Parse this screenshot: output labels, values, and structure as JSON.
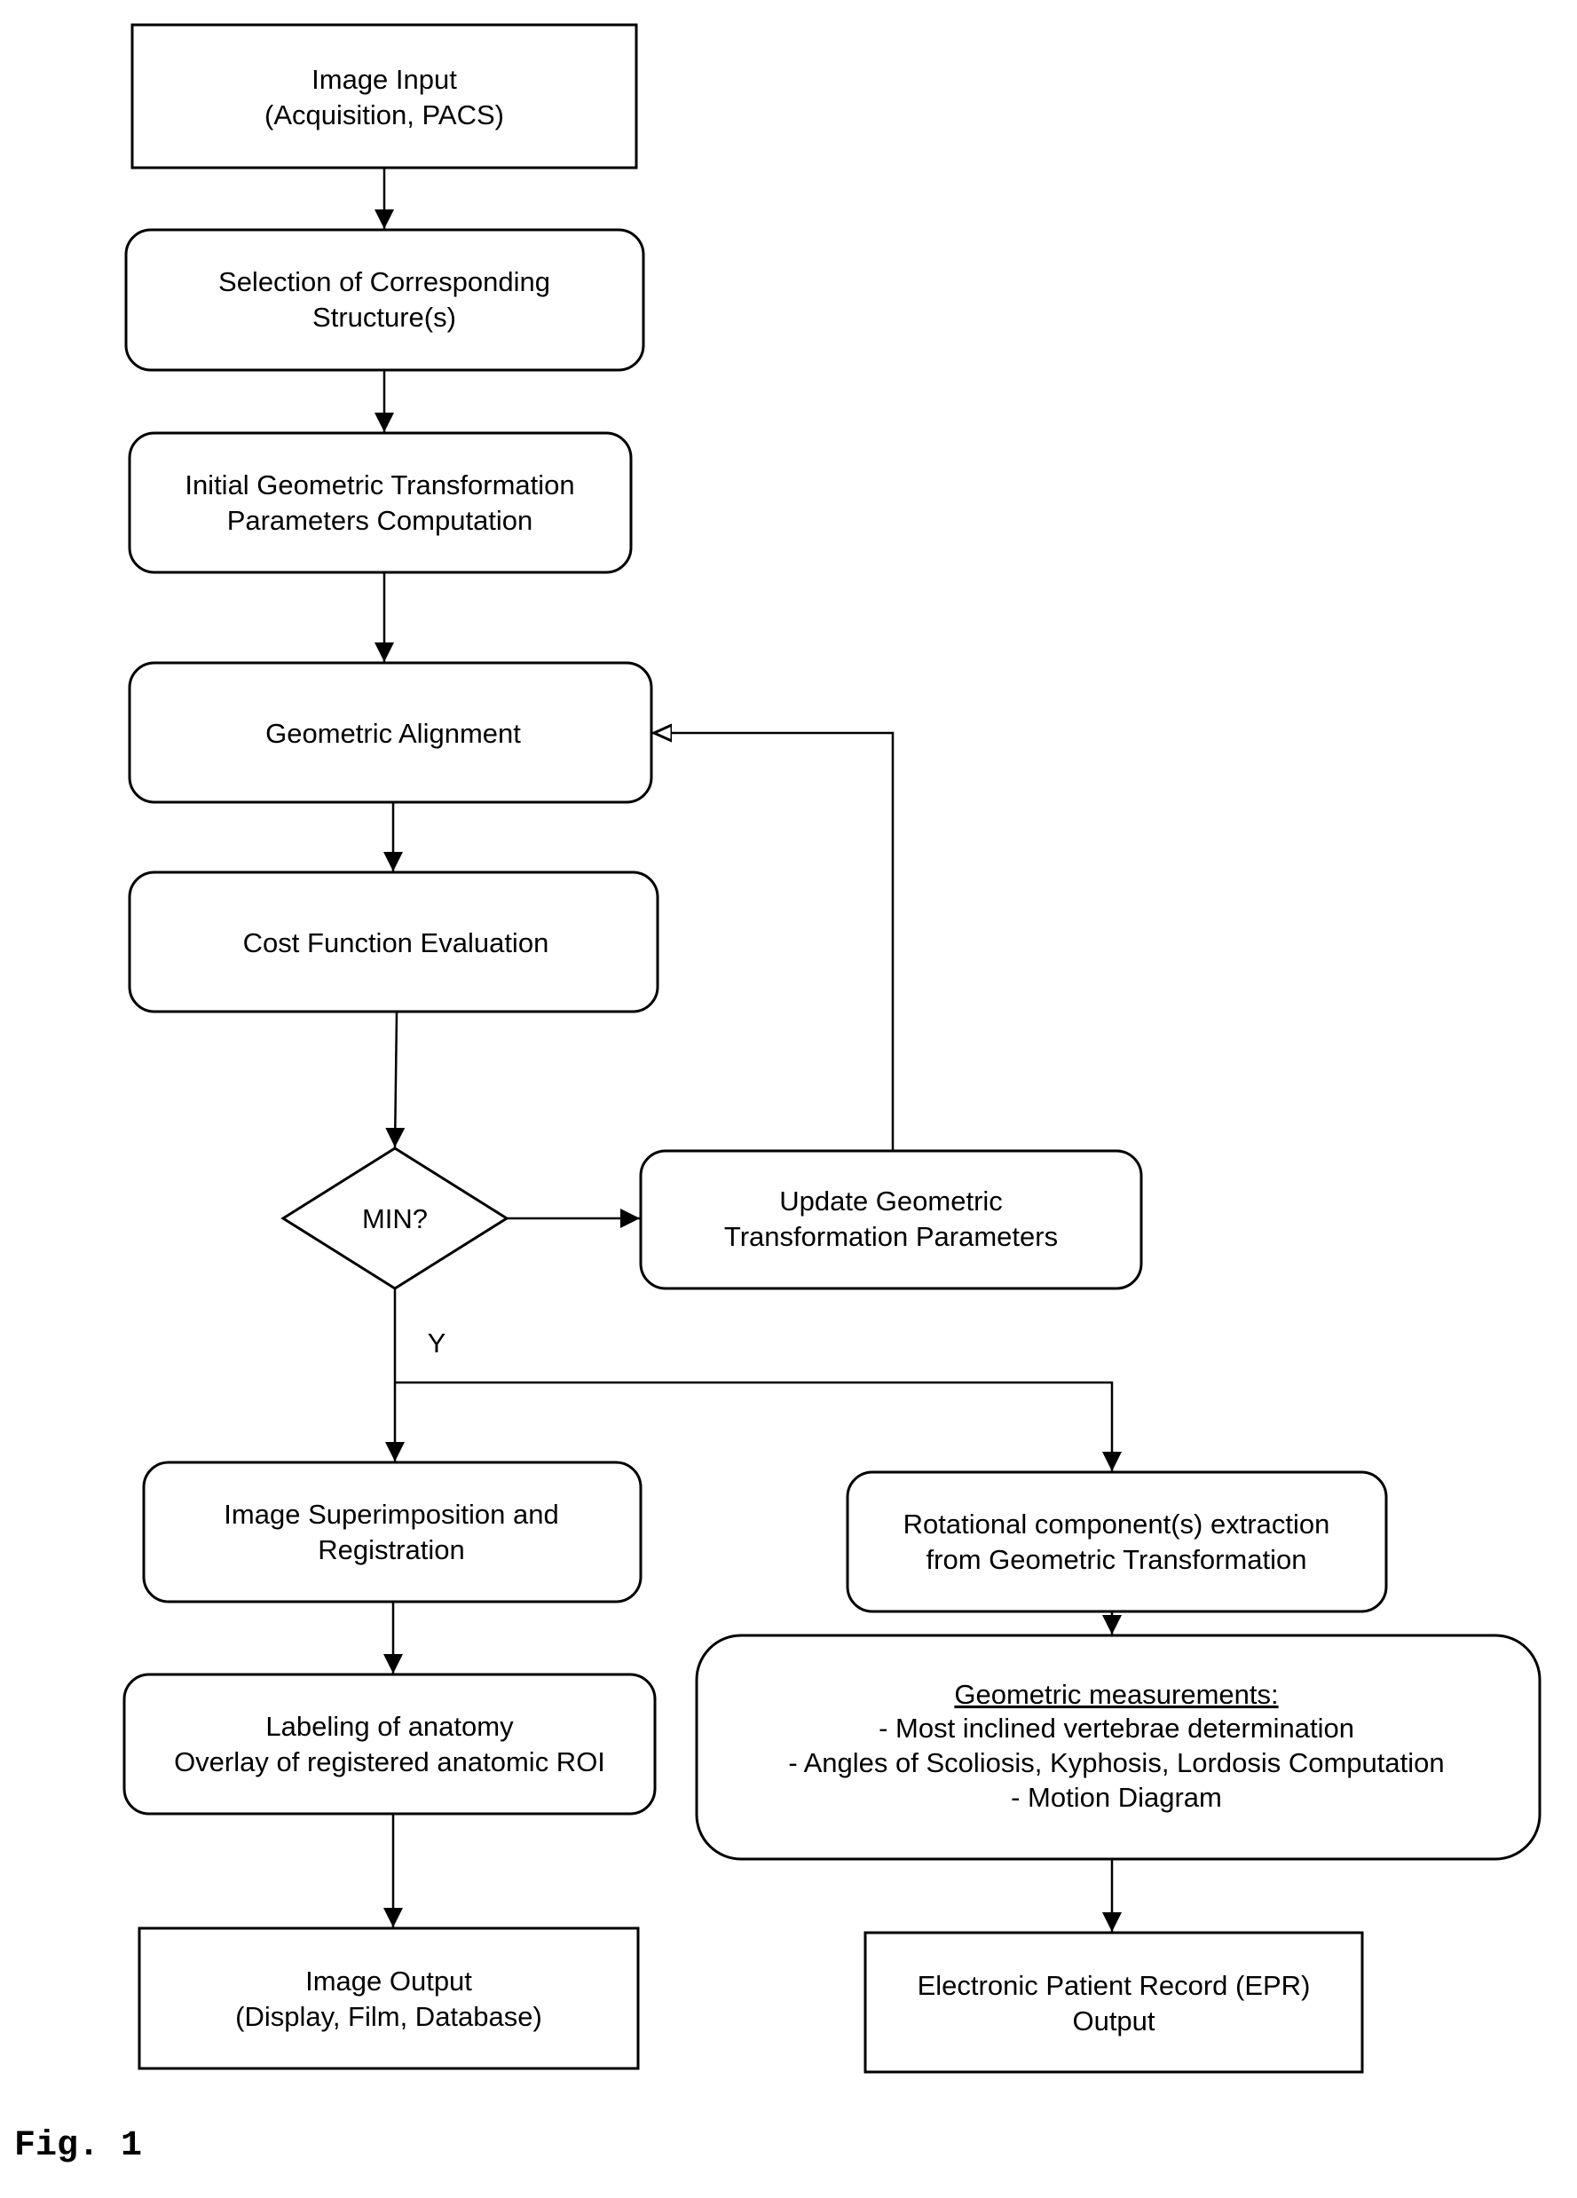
{
  "figure": {
    "caption": "Fig. 1",
    "nodes": {
      "image_input": {
        "lines": [
          "Image Input",
          "(Acquisition, PACS)"
        ]
      },
      "selection": {
        "lines": [
          "Selection of Corresponding",
          "Structure(s)"
        ]
      },
      "initial_params": {
        "lines": [
          "Initial Geometric Transformation",
          "Parameters Computation"
        ]
      },
      "alignment": {
        "lines": [
          "Geometric Alignment"
        ]
      },
      "cost": {
        "lines": [
          "Cost Function Evaluation"
        ]
      },
      "decision": {
        "lines": [
          "MIN?"
        ]
      },
      "update": {
        "lines": [
          "Update Geometric",
          "Transformation Parameters"
        ]
      },
      "superimposition": {
        "lines": [
          "Image Superimposition and",
          "Registration"
        ]
      },
      "labeling": {
        "lines": [
          "Labeling of anatomy",
          "Overlay of registered anatomic ROI"
        ]
      },
      "image_output": {
        "lines": [
          "Image Output",
          "(Display, Film, Database)"
        ]
      },
      "rotational": {
        "lines": [
          "Rotational component(s) extraction",
          "from Geometric Transformation"
        ]
      },
      "measurements": {
        "heading": "Geometric measurements:",
        "lines": [
          "- Most inclined vertebrae determination",
          "- Angles of Scoliosis, Kyphosis, Lordosis Computation",
          "- Motion Diagram"
        ]
      },
      "epr": {
        "lines": [
          "Electronic Patient Record (EPR)",
          "Output"
        ]
      }
    },
    "edge_labels": {
      "yes": "Y"
    }
  }
}
